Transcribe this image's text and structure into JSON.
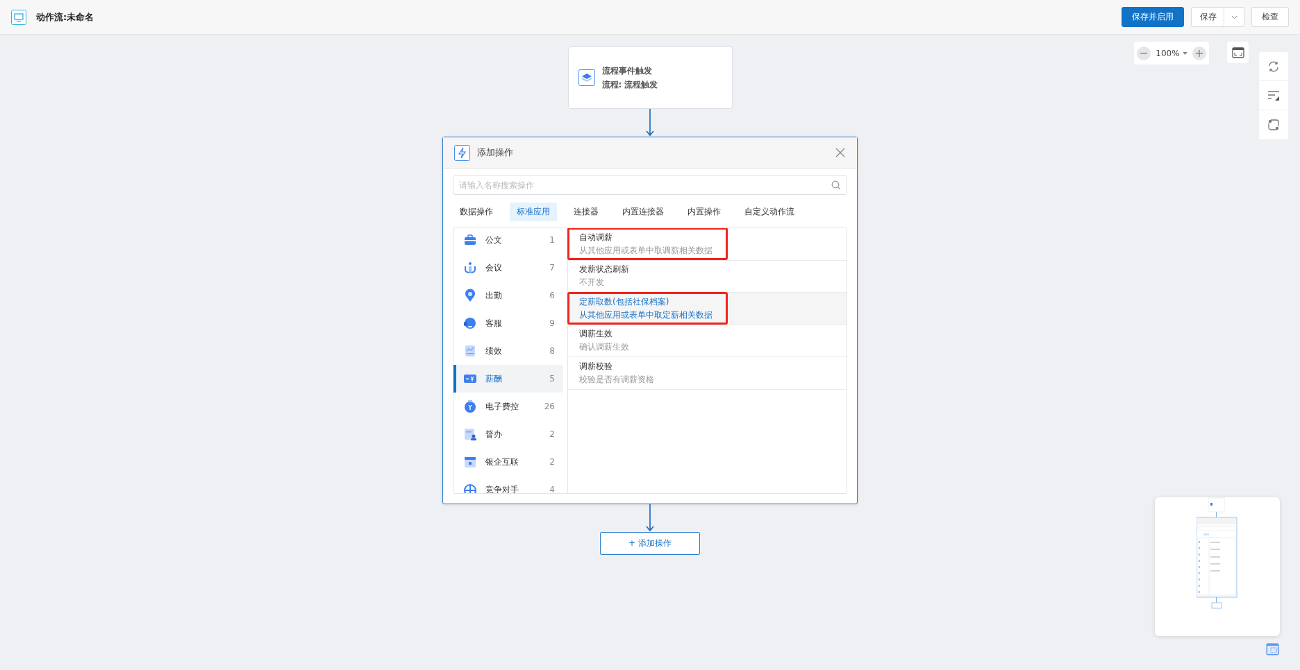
{
  "app": {
    "title": "动作流:未命名"
  },
  "toolbar": {
    "buttons": [
      {
        "label": "保存并启用",
        "kind": "primary"
      },
      {
        "label": "保存",
        "kind": "split"
      },
      {
        "label": "检查",
        "kind": "plain"
      }
    ]
  },
  "zoom": {
    "value": "100%"
  },
  "trigger_node": {
    "title": "流程事件触发",
    "subtitle": "流程: 流程触发"
  },
  "dialog": {
    "title": "添加操作",
    "search": {
      "placeholder": "请输入名称搜索操作"
    },
    "tabs": [
      {
        "label": "数据操作",
        "selected": false
      },
      {
        "label": "标准应用",
        "selected": true
      },
      {
        "label": "连接器",
        "selected": false
      },
      {
        "label": "内置连接器",
        "selected": false
      },
      {
        "label": "内置操作",
        "selected": false
      },
      {
        "label": "自定义动作流",
        "selected": false
      }
    ],
    "categories": [
      {
        "label": "公文",
        "count": "1",
        "selected": false
      },
      {
        "label": "会议",
        "count": "7",
        "selected": false
      },
      {
        "label": "出勤",
        "count": "6",
        "selected": false
      },
      {
        "label": "客服",
        "count": "9",
        "selected": false
      },
      {
        "label": "绩效",
        "count": "8",
        "selected": false
      },
      {
        "label": "薪酬",
        "count": "5",
        "selected": true
      },
      {
        "label": "电子费控",
        "count": "26",
        "selected": false
      },
      {
        "label": "督办",
        "count": "2",
        "selected": false
      },
      {
        "label": "银企互联",
        "count": "2",
        "selected": false
      },
      {
        "label": "竞争对手",
        "count": "4",
        "selected": false
      }
    ],
    "operations": [
      {
        "title": "自动调薪",
        "description": "从其他应用或表单中取调薪相关数据",
        "selected": false,
        "highlighted": true
      },
      {
        "title": "发薪状态刷新",
        "description": "不开发",
        "selected": false,
        "highlighted": false
      },
      {
        "title": "定薪取数(包括社保档案)",
        "description": "从其他应用或表单中取定薪相关数据",
        "selected": true,
        "highlighted": true
      },
      {
        "title": "调薪生效",
        "description": "确认调薪生效",
        "selected": false,
        "highlighted": false
      },
      {
        "title": "调薪校验",
        "description": "校验是否有调薪资格",
        "selected": false,
        "highlighted": false
      }
    ]
  },
  "add_button": {
    "label": "+ 添加操作"
  }
}
